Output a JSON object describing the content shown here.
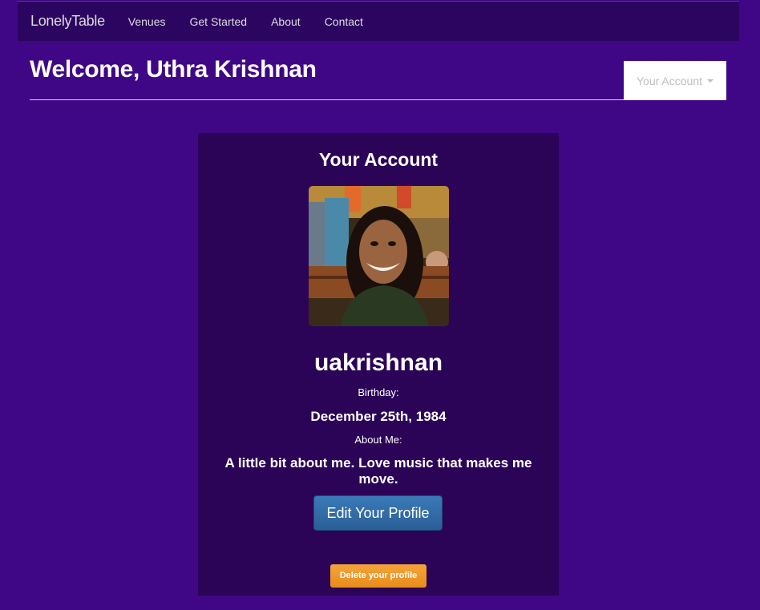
{
  "navbar": {
    "brand": "LonelyTable",
    "links": [
      "Venues",
      "Get Started",
      "About",
      "Contact"
    ]
  },
  "header": {
    "welcome": "Welcome, Uthra Krishnan",
    "account_dropdown": "Your Account"
  },
  "profile": {
    "title": "Your Account",
    "username": "uakrishnan",
    "birthday_label": "Birthday:",
    "birthday_value": "December 25th, 1984",
    "about_label": "About Me:",
    "about_value": "A little bit about me. Love music that makes me move.",
    "edit_button": "Edit Your Profile",
    "delete_button": "Delete your profile"
  },
  "colors": {
    "page_bg": "#3f0785",
    "navbar_bg": "#2c0561",
    "card_bg": "#2b0458",
    "edit_button": "#2f6aa4",
    "delete_button": "#ee9729"
  }
}
